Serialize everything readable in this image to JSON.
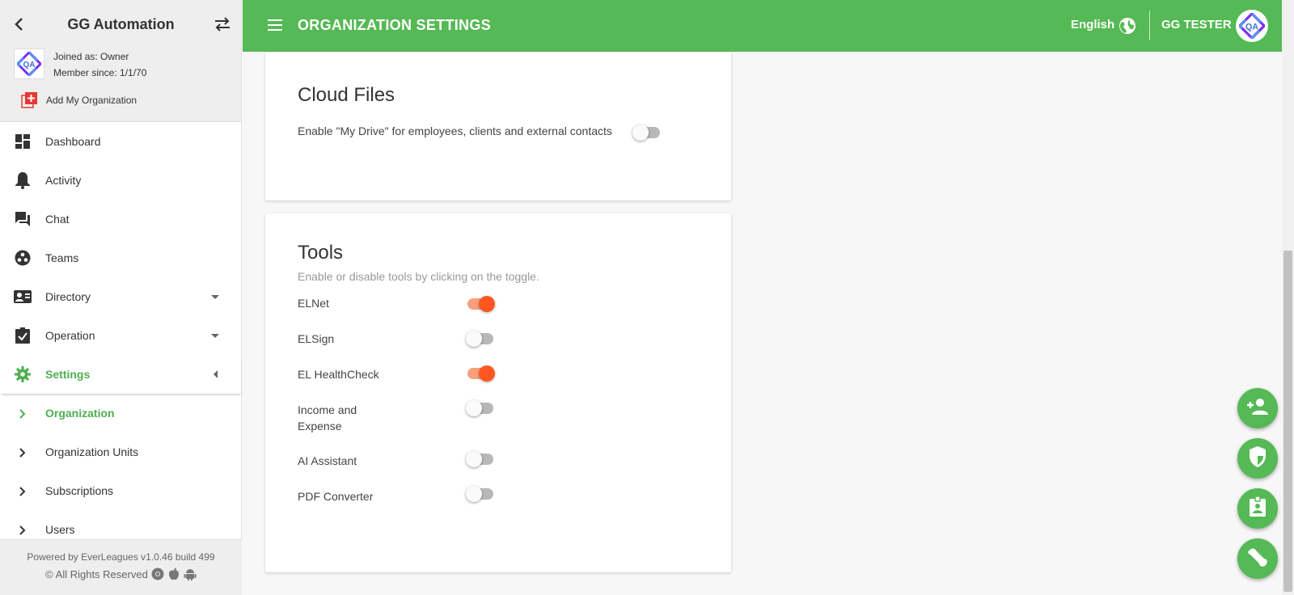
{
  "sidebar": {
    "org_name": "GG Automation",
    "joined_as": "Joined as: Owner",
    "member_since": "Member since: 1/1/70",
    "add_org_label": "Add My Organization",
    "items": [
      {
        "label": "Dashboard",
        "icon": "dashboard-icon"
      },
      {
        "label": "Activity",
        "icon": "bell-icon"
      },
      {
        "label": "Chat",
        "icon": "chat-icon"
      },
      {
        "label": "Teams",
        "icon": "teams-icon"
      },
      {
        "label": "Directory",
        "icon": "contact-card-icon"
      },
      {
        "label": "Operation",
        "icon": "clipboard-check-icon"
      },
      {
        "label": "Settings",
        "icon": "gear-icon"
      }
    ],
    "settings_subitems": [
      {
        "label": "Organization"
      },
      {
        "label": "Organization Units"
      },
      {
        "label": "Subscriptions"
      },
      {
        "label": "Users"
      }
    ],
    "footer_line1": "Powered by EverLeagues v1.0.46 build 499",
    "footer_line2": "© All Rights Reserved"
  },
  "header": {
    "title": "ORGANIZATION SETTINGS",
    "language": "English",
    "user_name": "GG TESTER"
  },
  "cloud_files": {
    "title": "Cloud Files",
    "label": "Enable \"My Drive\" for employees, clients and external contacts",
    "enabled": false
  },
  "tools": {
    "title": "Tools",
    "description": "Enable or disable tools by clicking on the toggle.",
    "items": [
      {
        "label": "ELNet",
        "enabled": true
      },
      {
        "label": "ELSign",
        "enabled": false
      },
      {
        "label": "EL HealthCheck",
        "enabled": true
      },
      {
        "label": "Income and Expense",
        "enabled": false
      },
      {
        "label": "AI Assistant",
        "enabled": false
      },
      {
        "label": "PDF Converter",
        "enabled": false
      }
    ]
  },
  "colors": {
    "primary": "#55b955",
    "toggle_on": "#ff5722",
    "active_nav": "#4caf50"
  },
  "fabs": [
    "add-person-icon",
    "shield-icon",
    "badge-icon",
    "wrench-icon"
  ]
}
